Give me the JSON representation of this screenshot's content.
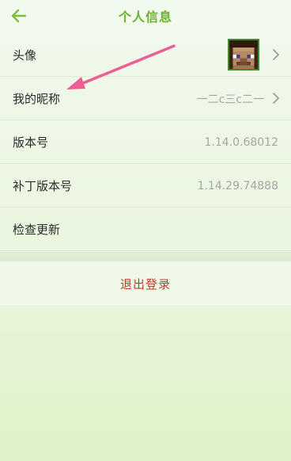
{
  "header": {
    "title": "个人信息",
    "back_icon": "arrow-left-icon",
    "accent_color": "#6bb12c"
  },
  "rows": [
    {
      "label": "头像",
      "value": "",
      "has_arrow": true
    },
    {
      "label": "我的昵称",
      "value": "一二c三c二一",
      "has_arrow": true
    },
    {
      "label": "版本号",
      "value": "1.14.0.68012",
      "has_arrow": false
    },
    {
      "label": "补丁版本号",
      "value": "1.14.29.74888",
      "has_arrow": false
    },
    {
      "label": "检查更新",
      "value": "",
      "has_arrow": false
    }
  ],
  "logout": {
    "label": "退出登录",
    "color": "#c0392b"
  },
  "annotation": {
    "type": "pink-arrow",
    "color": "#ec5f95"
  }
}
